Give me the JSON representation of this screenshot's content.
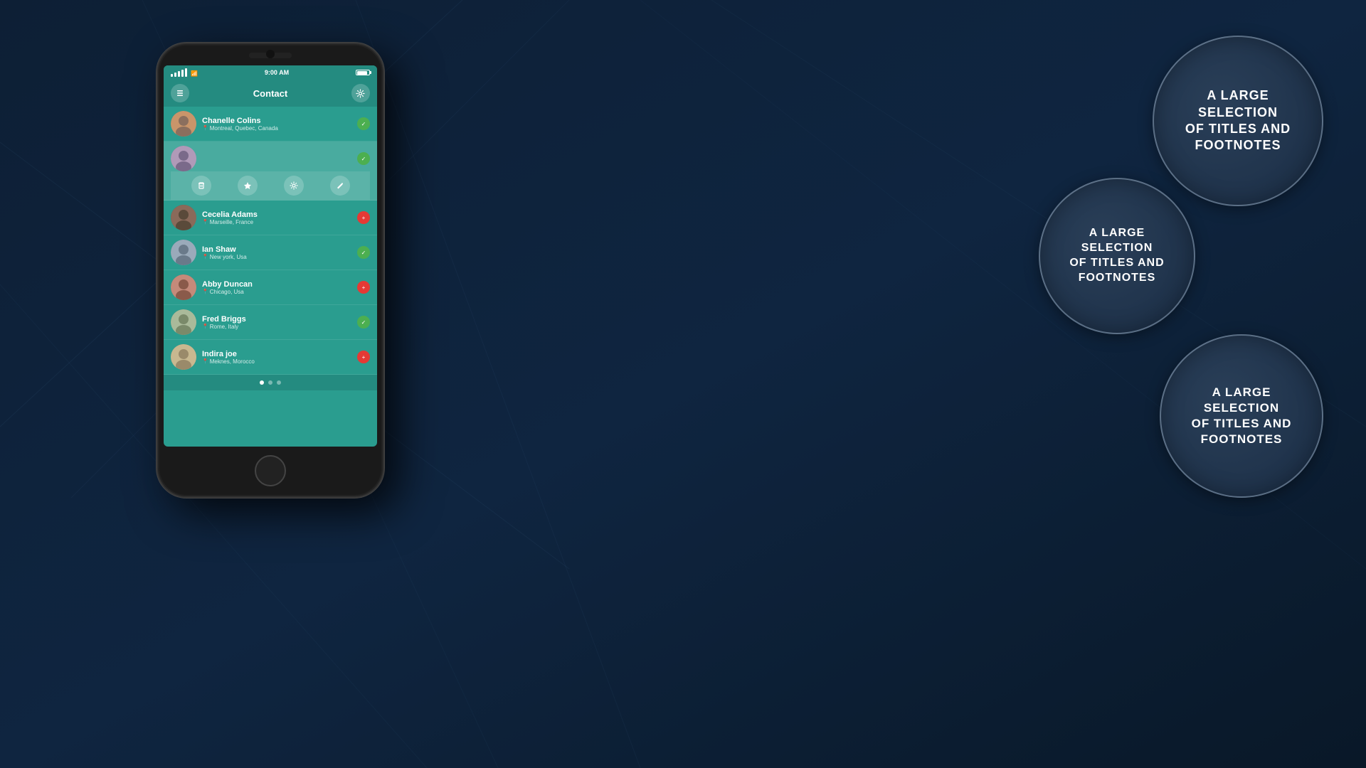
{
  "background": {
    "color": "#0d1f35"
  },
  "phone": {
    "status_bar": {
      "signal": "●●●●●",
      "wifi": "wifi",
      "time": "9:00 AM",
      "battery": "█"
    },
    "header": {
      "title": "Contact",
      "back_icon": "≡",
      "settings_icon": "⚙"
    },
    "contacts": [
      {
        "name": "Chanelle Colins",
        "location": "Montreal, Quebec, Canada",
        "status": "online",
        "expanded": false
      },
      {
        "name": "",
        "location": "",
        "status": "online",
        "expanded": true,
        "actions": [
          "delete",
          "star",
          "settings",
          "edit"
        ]
      },
      {
        "name": "Cecelia Adams",
        "location": "Marseille, France",
        "status": "add",
        "expanded": false
      },
      {
        "name": "Ian Shaw",
        "location": "New york, Usa",
        "status": "online",
        "expanded": false
      },
      {
        "name": "Abby Duncan",
        "location": "Chicago, Usa",
        "status": "add",
        "expanded": false
      },
      {
        "name": "Fred Briggs",
        "location": "Rome, Italy",
        "status": "online",
        "expanded": false
      },
      {
        "name": "Indira joe",
        "location": "Meknes, Morocco",
        "status": "add",
        "expanded": false
      }
    ],
    "page_dots": 3,
    "active_dot": 0
  },
  "bubbles": [
    {
      "text": "A LARGE\nSELECTION\nOF TITLES AND\nFOOTNOTES",
      "size": "large",
      "position": "top-right"
    },
    {
      "text": "A LARGE\nSELECTION\nOF TITLES AND\nFOOTNOTES",
      "size": "medium",
      "position": "middle-left"
    },
    {
      "text": "A LARGE\nSELECTION\nOF TITLES AND\nFOOTNOTES",
      "size": "large",
      "position": "bottom-right"
    }
  ]
}
